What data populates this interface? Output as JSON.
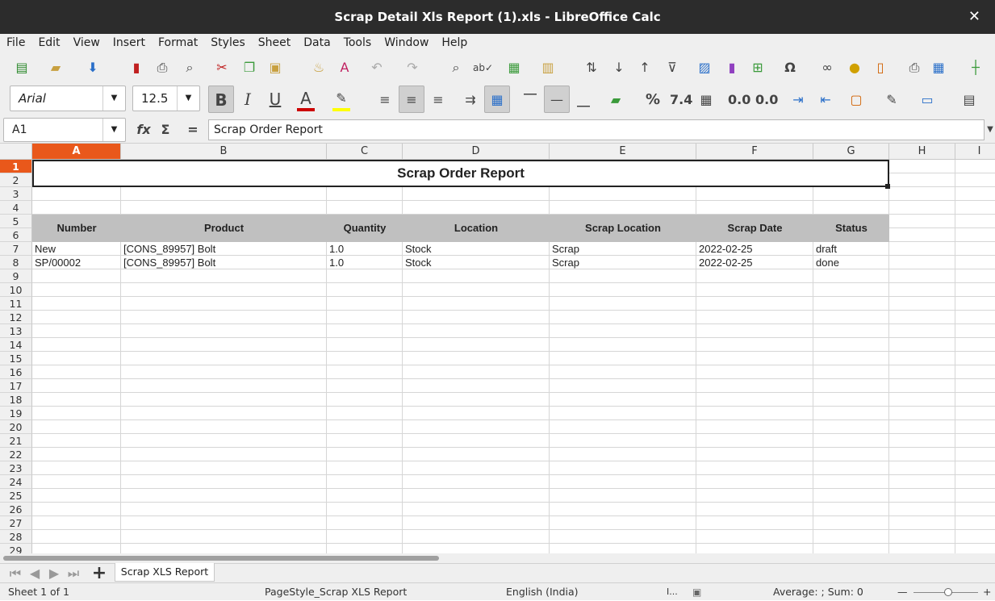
{
  "window": {
    "title": "Scrap Detail Xls Report (1).xls - LibreOffice Calc",
    "close_glyph": "✕"
  },
  "menu": [
    "File",
    "Edit",
    "View",
    "Insert",
    "Format",
    "Styles",
    "Sheet",
    "Data",
    "Tools",
    "Window",
    "Help"
  ],
  "toolbar": {
    "font_name": "Arial",
    "font_size": "12.5",
    "font_color": "#cc0000",
    "highlight_color": "#ffff00",
    "bold_label": "B",
    "italic_label": "I",
    "underline_label": "U",
    "percent_label": "%",
    "number_label": "7.4",
    "add_decimal_label": "0.0",
    "del_decimal_label": "0.0"
  },
  "formula": {
    "cell_ref": "A1",
    "value": "Scrap Order Report",
    "fx_label": "fx",
    "sigma_label": "Σ",
    "equals_label": "="
  },
  "columns": [
    "A",
    "B",
    "C",
    "D",
    "E",
    "F",
    "G",
    "H",
    "I"
  ],
  "rows": [
    "1",
    "2",
    "3",
    "4",
    "5",
    "6",
    "7",
    "8",
    "9",
    "10",
    "11",
    "12",
    "13",
    "14",
    "15",
    "16",
    "17",
    "18",
    "19",
    "20",
    "21",
    "22",
    "23",
    "24",
    "25",
    "26",
    "27",
    "28",
    "29"
  ],
  "sheet": {
    "title": "Scrap Order Report",
    "headers": [
      "Number",
      "Product",
      "Quantity",
      "Location",
      "Scrap Location",
      "Scrap Date",
      "Status"
    ],
    "data": [
      [
        "New",
        "[CONS_89957] Bolt",
        "1.0",
        "Stock",
        "Scrap",
        "2022-02-25",
        "draft"
      ],
      [
        "SP/00002",
        "[CONS_89957] Bolt",
        "1.0",
        "Stock",
        "Scrap",
        "2022-02-25",
        "done"
      ]
    ]
  },
  "tabs": {
    "add_label": "+",
    "active": "Scrap XLS Report"
  },
  "status": {
    "sheet": "Sheet 1 of 1",
    "page_style": "PageStyle_Scrap XLS Report",
    "language": "English (India)",
    "ime": "I...",
    "summary": "Average: ; Sum: 0",
    "zoom_minus": "—",
    "zoom_plus": "+"
  }
}
